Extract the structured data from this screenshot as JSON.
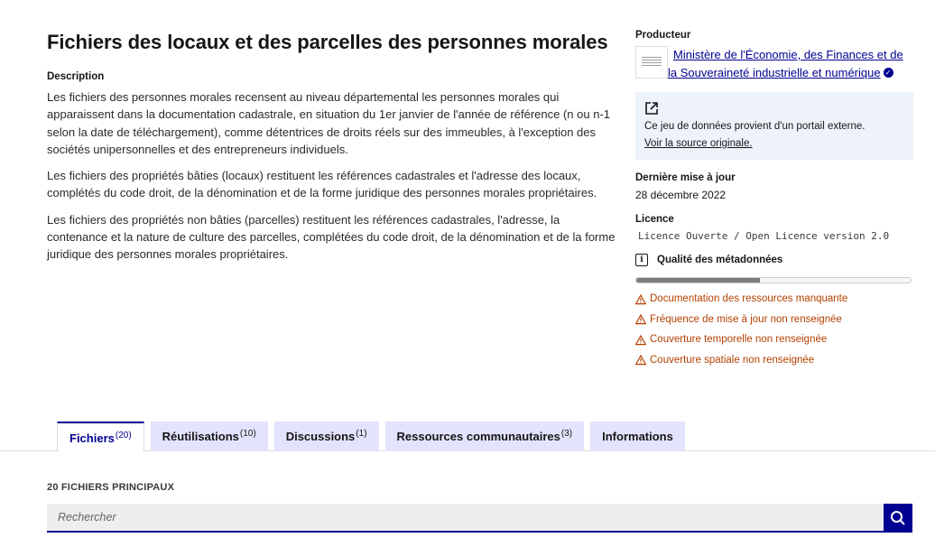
{
  "dataset": {
    "title": "Fichiers des locaux et des parcelles des personnes morales",
    "description_label": "Description",
    "paragraphs": [
      "Les fichiers des personnes morales recensent au niveau départemental les personnes morales qui apparaissent dans la documentation cadastrale, en situation du 1er janvier de l'année de référence (n ou n-1 selon la date de téléchargement), comme détentrices de droits réels sur des immeubles, à l'exception des sociétés unipersonnelles et des entrepreneurs individuels.",
      "Les fichiers des propriétés bâties (locaux) restituent les références cadastrales et l'adresse des locaux, complétés du code droit, de la dénomination et de la forme juridique des personnes morales propriétaires.",
      "Les fichiers des propriétés non bâties (parcelles) restituent les références cadastrales, l'adresse, la contenance et la nature de culture des parcelles, complétées du code droit, de la dénomination et de la forme juridique des personnes morales propriétaires."
    ]
  },
  "sidebar": {
    "producer_label": "Producteur",
    "producer_name": "Ministère de l'Économie, des Finances et de la Souveraineté industrielle et numérique",
    "external_text": "Ce jeu de données provient d'un portail externe.",
    "external_link": "Voir la source originale.",
    "last_update_label": "Dernière mise à jour",
    "last_update_value": "28 décembre 2022",
    "licence_label": "Licence",
    "licence_value": "Licence Ouverte / Open Licence version 2.0",
    "quality_label": "Qualité des métadonnées",
    "quality_progress_percent": 45,
    "warnings": [
      "Documentation des ressources manquante",
      "Fréquence de mise à jour non renseignée",
      "Couverture temporelle non renseignée",
      "Couverture spatiale non renseignée"
    ]
  },
  "tabs": [
    {
      "label": "Fichiers",
      "count": "(20)",
      "active": true
    },
    {
      "label": "Réutilisations",
      "count": "(10)",
      "active": false
    },
    {
      "label": "Discussions",
      "count": "(1)",
      "active": false
    },
    {
      "label": "Ressources communautaires",
      "count": "(3)",
      "active": false
    },
    {
      "label": "Informations",
      "count": "",
      "active": false
    }
  ],
  "files": {
    "heading": "20 FICHIERS PRINCIPAUX",
    "search_placeholder": "Rechercher"
  },
  "colors": {
    "accent": "#000091",
    "warning": "#b34000",
    "tab_bg": "#e3e3fd"
  },
  "icons": {
    "external": "external-link-icon",
    "info": "info-icon",
    "warning": "warning-icon",
    "verified": "verified-icon",
    "search": "search-icon"
  }
}
